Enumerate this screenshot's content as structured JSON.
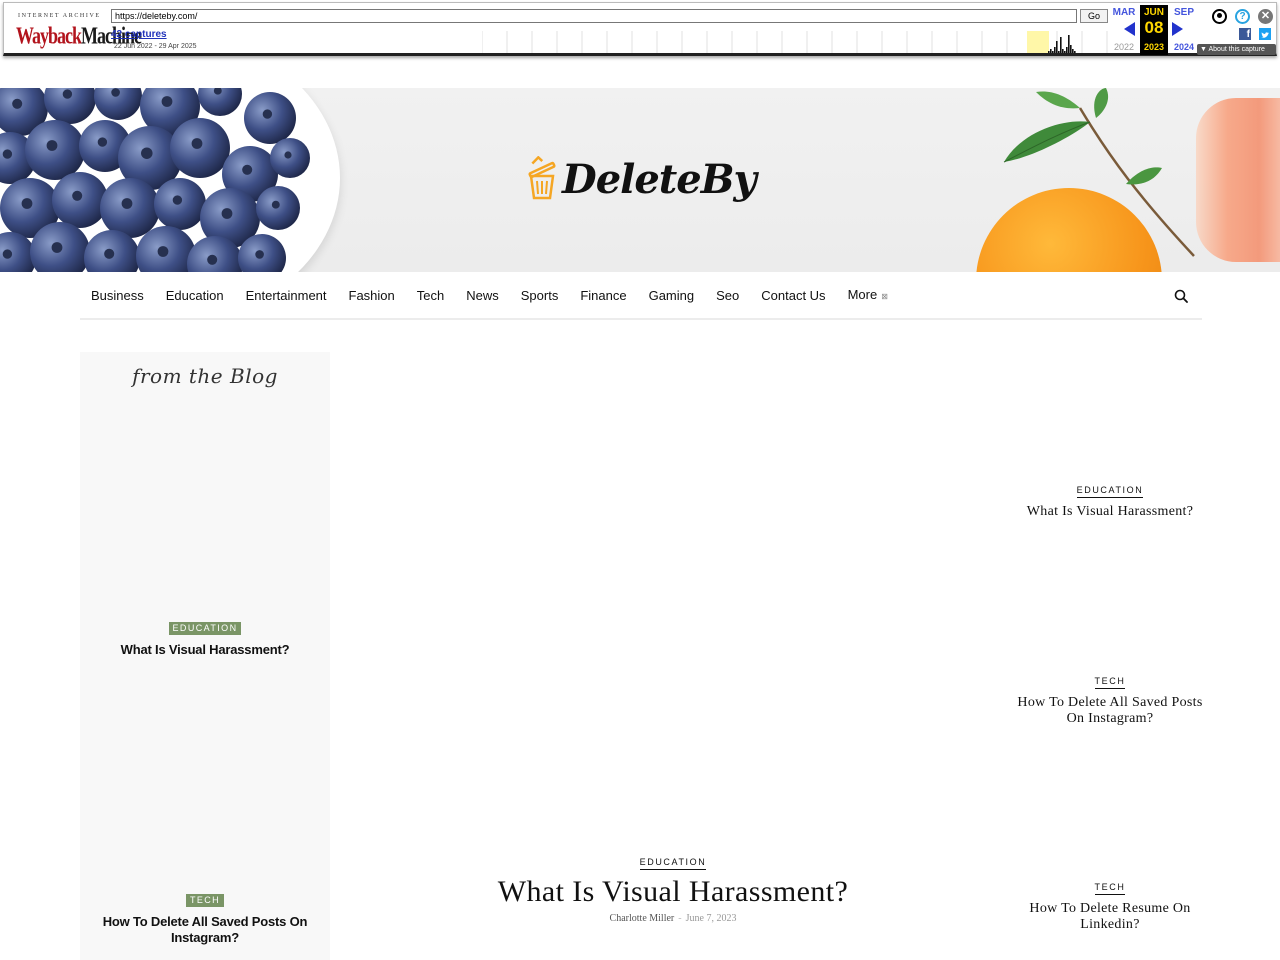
{
  "wayback": {
    "logo_top": "INTERNET ARCHIVE",
    "logo_main_a": "Wayback",
    "logo_main_b": "Machine",
    "url_value": "https://deleteby.com/",
    "go_label": "Go",
    "captures_label": "42 captures",
    "date_range": "22 Jun 2022 - 29 Apr 2025",
    "prev_month": "MAR",
    "current_month": "JUN",
    "current_day": "08",
    "next_month": "SEP",
    "prev_year": "2022",
    "current_year": "2023",
    "next_year": "2024",
    "about_label": "About this capture",
    "help_glyph": "?",
    "close_glyph": "✕",
    "facebook_glyph": "f",
    "sparkline": [
      0,
      0,
      0,
      0,
      0,
      0,
      0,
      0,
      0,
      0,
      0,
      0,
      0,
      0,
      0,
      0,
      0,
      0,
      0,
      0,
      0,
      0,
      0,
      0,
      0,
      0,
      0,
      0,
      0,
      0,
      0,
      0,
      1,
      2,
      1,
      3,
      6,
      1,
      8,
      2,
      1,
      3,
      9,
      4,
      2,
      1,
      0,
      0,
      0,
      0
    ]
  },
  "site": {
    "name": "DeleteBy",
    "colors": {
      "badge_green": "#7a9566",
      "logo_orange": "#f5a623",
      "text": "#111111"
    }
  },
  "nav": {
    "items": [
      {
        "label": "Business"
      },
      {
        "label": "Education"
      },
      {
        "label": "Entertainment"
      },
      {
        "label": "Fashion"
      },
      {
        "label": "Tech"
      },
      {
        "label": "News"
      },
      {
        "label": "Sports"
      },
      {
        "label": "Finance"
      },
      {
        "label": "Gaming"
      },
      {
        "label": "Seo"
      },
      {
        "label": "Contact Us"
      },
      {
        "label": "More"
      }
    ],
    "search_icon": "search-icon"
  },
  "sidebar": {
    "title": "from the Blog",
    "posts": [
      {
        "category": "EDUCATION",
        "title": "What Is Visual Harassment?"
      },
      {
        "category": "TECH",
        "title": "How To Delete All Saved Posts On Instagram?"
      }
    ]
  },
  "featured": {
    "category": "EDUCATION",
    "title": "What Is Visual Harassment?",
    "author": "Charlotte Miller",
    "separator": "-",
    "date": "June 7, 2023"
  },
  "right_posts": [
    {
      "category": "EDUCATION",
      "title": "What Is Visual Harassment?"
    },
    {
      "category": "TECH",
      "title": "How To Delete All Saved Posts On Instagram?"
    },
    {
      "category": "TECH",
      "title": "How To Delete Resume On Linkedin?"
    }
  ]
}
